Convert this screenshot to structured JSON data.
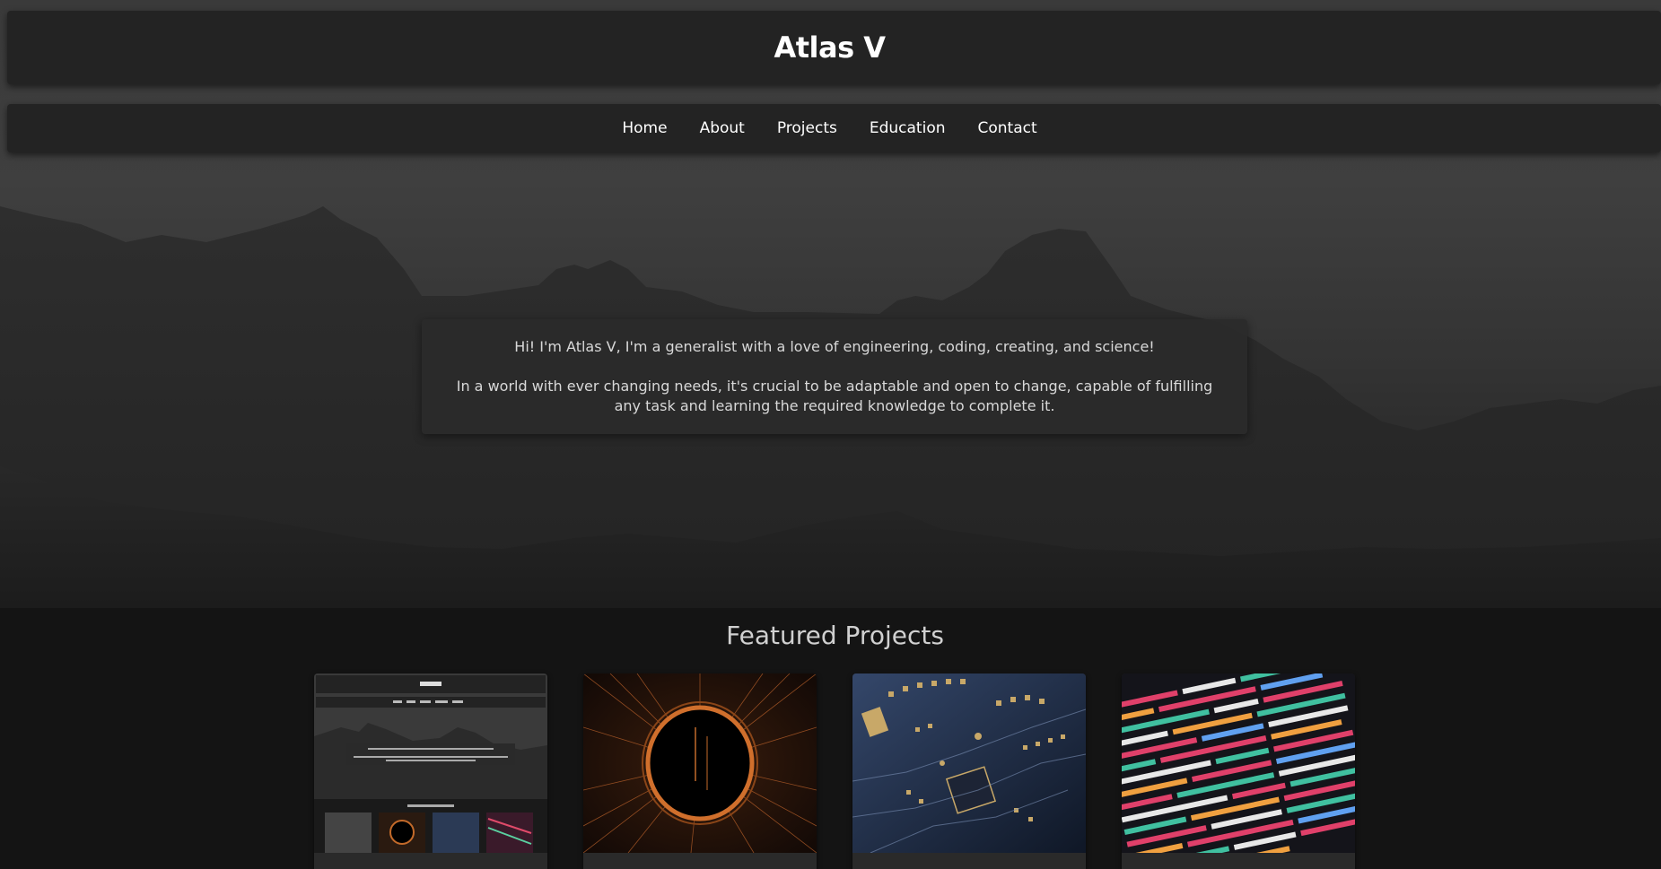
{
  "header": {
    "title": "Atlas V"
  },
  "nav": {
    "items": [
      {
        "label": "Home"
      },
      {
        "label": "About"
      },
      {
        "label": "Projects"
      },
      {
        "label": "Education"
      },
      {
        "label": "Contact"
      }
    ]
  },
  "intro": {
    "line1": "Hi! I'm Atlas V, I'm a generalist with a love of engineering, coding, creating, and science!",
    "line2": "In a world with ever changing needs, it's crucial to be adaptable and open to change, capable of fulfilling any task and learning the required knowledge to complete it."
  },
  "featured": {
    "title": "Featured Projects",
    "projects": [
      {
        "thumbnail": "website-screenshot"
      },
      {
        "thumbnail": "orange-black-hole"
      },
      {
        "thumbnail": "circuit-board"
      },
      {
        "thumbnail": "colorful-code"
      }
    ]
  },
  "colors": {
    "page_bg": "#141414",
    "bar_bg": "#232323",
    "text": "#ffffff",
    "muted_text": "#d8d8d8"
  }
}
